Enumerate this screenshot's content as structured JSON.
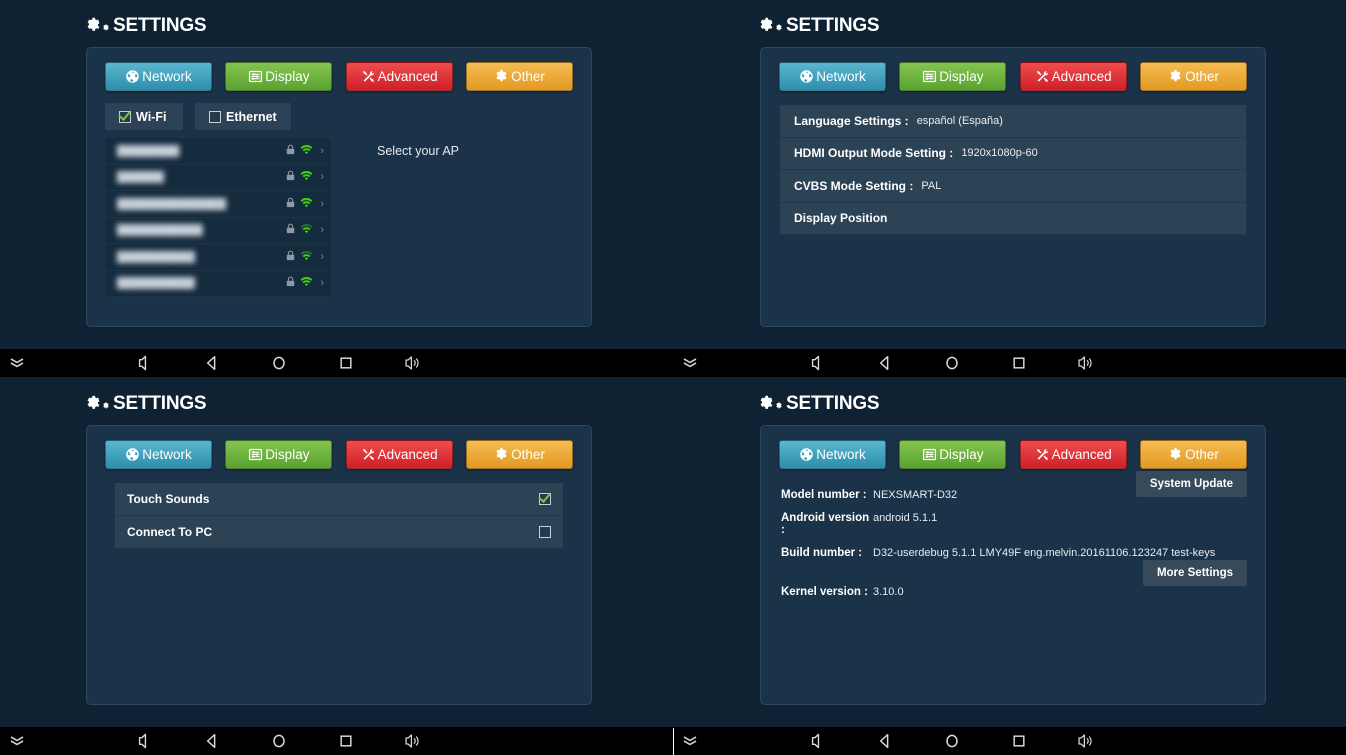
{
  "app": {
    "title": "SETTINGS",
    "colors": {
      "background": "#0e2234",
      "panel": "#1a3349",
      "panel_border": "#2a4961",
      "row": "#2c4255",
      "list": "#152b3e",
      "navbar": "#000000",
      "tab_network": "#2b8fae",
      "tab_display": "#5aa331",
      "tab_advanced": "#cf1f28",
      "tab_other": "#e39a23",
      "wifi_signal": "#3fd20a",
      "check": "#7ac943"
    }
  },
  "tabs": [
    {
      "id": "network",
      "label": "Network",
      "icon": "globe-icon"
    },
    {
      "id": "display",
      "label": "Display",
      "icon": "sliders-icon"
    },
    {
      "id": "advanced",
      "label": "Advanced",
      "icon": "tools-icon"
    },
    {
      "id": "other",
      "label": "Other",
      "icon": "gear-icon"
    }
  ],
  "network": {
    "connections": [
      {
        "label": "Wi-Fi",
        "checked": true
      },
      {
        "label": "Ethernet",
        "checked": false
      }
    ],
    "hint": "Select your AP",
    "access_points": [
      {
        "name": "████████",
        "secured": true,
        "signal": 4
      },
      {
        "name": "██████",
        "secured": true,
        "signal": 4
      },
      {
        "name": "██████████████",
        "secured": true,
        "signal": 4
      },
      {
        "name": "███████████",
        "secured": true,
        "signal": 3
      },
      {
        "name": "██████████",
        "secured": true,
        "signal": 3
      },
      {
        "name": "██████████",
        "secured": true,
        "signal": 4
      }
    ]
  },
  "display": {
    "rows": [
      {
        "label": "Language Settings :",
        "value": "español (España)"
      },
      {
        "label": "HDMI Output Mode Setting :",
        "value": "1920x1080p-60"
      },
      {
        "label": "CVBS Mode Setting :",
        "value": "PAL"
      },
      {
        "label": "Display Position",
        "value": ""
      }
    ]
  },
  "advanced": {
    "rows": [
      {
        "label": "Touch Sounds",
        "checked": true
      },
      {
        "label": "Connect To PC",
        "checked": false
      }
    ]
  },
  "other": {
    "info": [
      {
        "key": "Model number :",
        "value": "NEXSMART-D32"
      },
      {
        "key": "Android version :",
        "value": "android 5.1.1"
      },
      {
        "key": "Build number :",
        "value": "D32-userdebug 5.1.1 LMY49F eng.melvin.20161106.123247 test-keys"
      },
      {
        "key": "Kernel version :",
        "value": "3.10.0"
      }
    ],
    "buttons": [
      {
        "id": "system-update",
        "label": "System Update"
      },
      {
        "id": "more-settings",
        "label": "More Settings"
      }
    ]
  },
  "navbar": {
    "buttons": [
      {
        "id": "collapse",
        "icon": "chevron-double-down-icon"
      },
      {
        "id": "volume-down",
        "icon": "volume-down-icon"
      },
      {
        "id": "back",
        "icon": "back-triangle-icon"
      },
      {
        "id": "home",
        "icon": "home-circle-icon"
      },
      {
        "id": "recents",
        "icon": "recents-square-icon"
      },
      {
        "id": "volume-up",
        "icon": "volume-up-icon"
      }
    ]
  }
}
